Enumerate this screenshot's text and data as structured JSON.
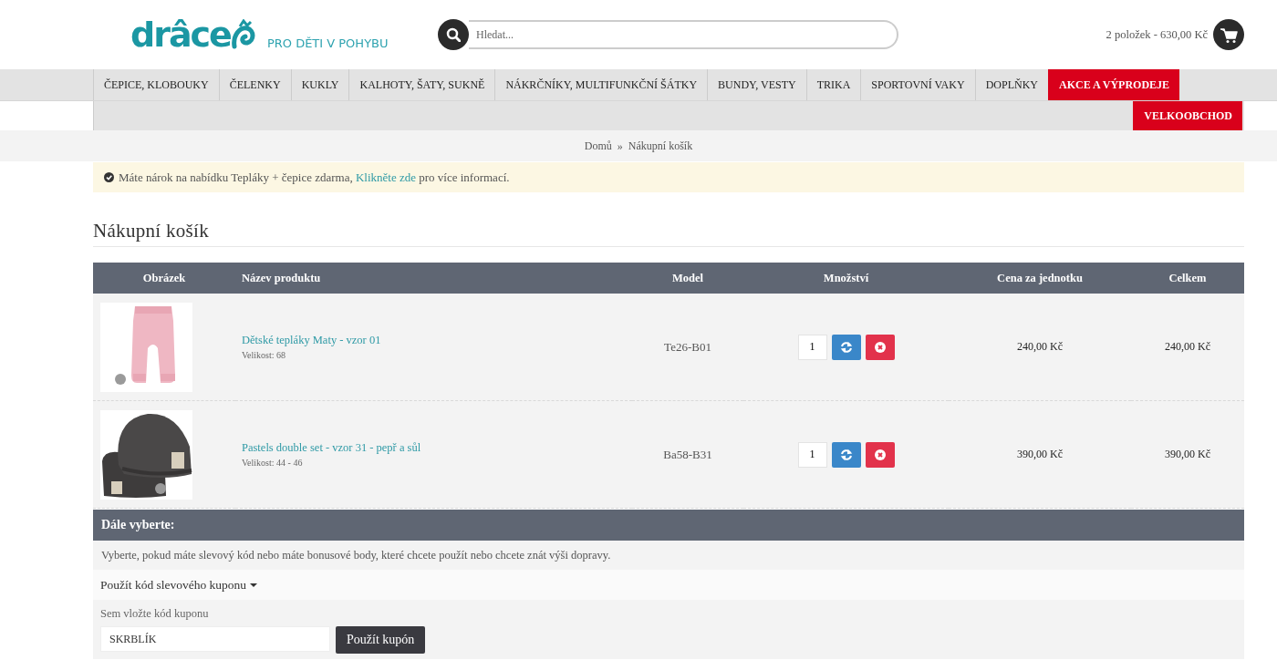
{
  "header": {
    "logo_text": "drâce",
    "tagline": "PRO DĚTI V POHYBU",
    "search": {
      "placeholder": "Hledat..."
    },
    "cart_summary": "2 položek - 630,00 Kč"
  },
  "nav": [
    {
      "label": "ČEPICE, KLOBOUKY",
      "kind": "normal"
    },
    {
      "label": "ČELENKY",
      "kind": "normal"
    },
    {
      "label": "KUKLY",
      "kind": "normal"
    },
    {
      "label": "KALHOTY, ŠATY, SUKNĚ",
      "kind": "normal"
    },
    {
      "label": "NÁKRČNÍKY, MULTIFUNKČNÍ ŠÁTKY",
      "kind": "normal"
    },
    {
      "label": "BUNDY, VESTY",
      "kind": "normal"
    },
    {
      "label": "TRIKA",
      "kind": "normal"
    },
    {
      "label": "SPORTOVNÍ VAKY",
      "kind": "normal"
    },
    {
      "label": "DOPLŇKY",
      "kind": "normal"
    },
    {
      "label": "AKCE A VÝPRODEJE",
      "kind": "promo"
    }
  ],
  "nav_second_row": [
    {
      "label": "VELKOOBCHOD",
      "kind": "promo"
    }
  ],
  "breadcrumb": {
    "items": [
      "Domů",
      "Nákupní košík"
    ],
    "separator": "»"
  },
  "notice": {
    "text": "Máte nárok na nabídku Tepláky + čepice zdarma, ",
    "link": "Klikněte zde",
    "after": " pro více informací."
  },
  "title": "Nákupní košík",
  "table": {
    "columns": [
      "Obrázek",
      "Název produktu",
      "Model",
      "Množství",
      "Cena za jednotku",
      "Celkem"
    ],
    "rows": [
      {
        "name": "Dětské tepláky Maty - vzor 01",
        "size": "Velikost: 68",
        "model": "Te26-B01",
        "quantity": "1",
        "unit_price": "240,00 Kč",
        "total": "240,00 Kč"
      },
      {
        "name": "Pastels double set - vzor 31 - pepř a sůl",
        "size": "Velikost: 44 - 46",
        "model": "Ba58-B31",
        "quantity": "1",
        "unit_price": "390,00 Kč",
        "total": "390,00 Kč"
      }
    ]
  },
  "next_steps": {
    "heading": "Dále vyberte:",
    "text": "Vyberte, pokud máte slevový kód nebo máte bonusové body, které chcete použít nebo chcete znát výši dopravy.",
    "coupon": {
      "toggle": "Použít kód slevového kuponu",
      "expanded": true,
      "label": "Sem vložte kód kuponu",
      "value": "SKRBLÍK",
      "button": "Použít kupón"
    }
  }
}
